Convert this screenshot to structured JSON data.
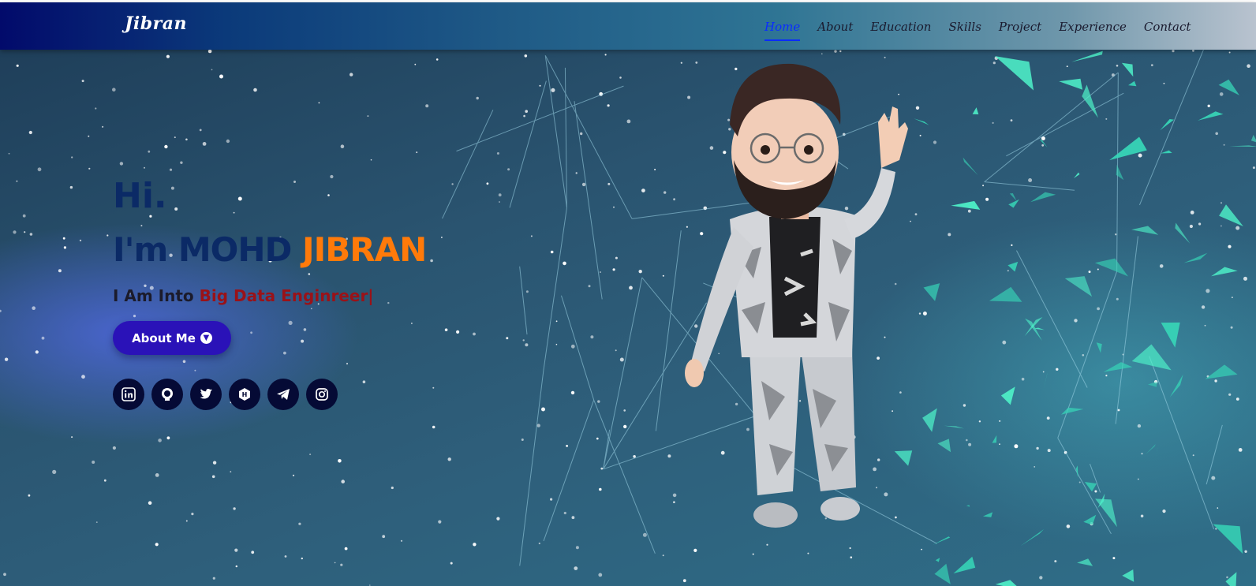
{
  "brand": {
    "logo": "Jibran"
  },
  "nav": {
    "items": [
      {
        "label": "Home",
        "active": true
      },
      {
        "label": "About"
      },
      {
        "label": "Education"
      },
      {
        "label": "Skills"
      },
      {
        "label": "Project"
      },
      {
        "label": "Experience"
      },
      {
        "label": "Contact"
      }
    ]
  },
  "hero": {
    "greeting": "Hi.",
    "intro_prefix": "I'm MOHD ",
    "intro_name": "JIBRAN",
    "into_prefix": "I Am Into ",
    "role": "Big Data Enginreer|",
    "button_label": "About Me"
  },
  "socials": [
    {
      "icon": "linkedin-icon"
    },
    {
      "icon": "github-icon"
    },
    {
      "icon": "twitter-icon"
    },
    {
      "icon": "hashnode-icon"
    },
    {
      "icon": "telegram-icon"
    },
    {
      "icon": "instagram-icon"
    }
  ],
  "colors": {
    "accent_orange": "#ff7a0a",
    "heading_navy": "#0b2a66",
    "role_red": "#9a1218",
    "button_blue": "#2a12b8",
    "nav_active": "#0a2cff"
  }
}
